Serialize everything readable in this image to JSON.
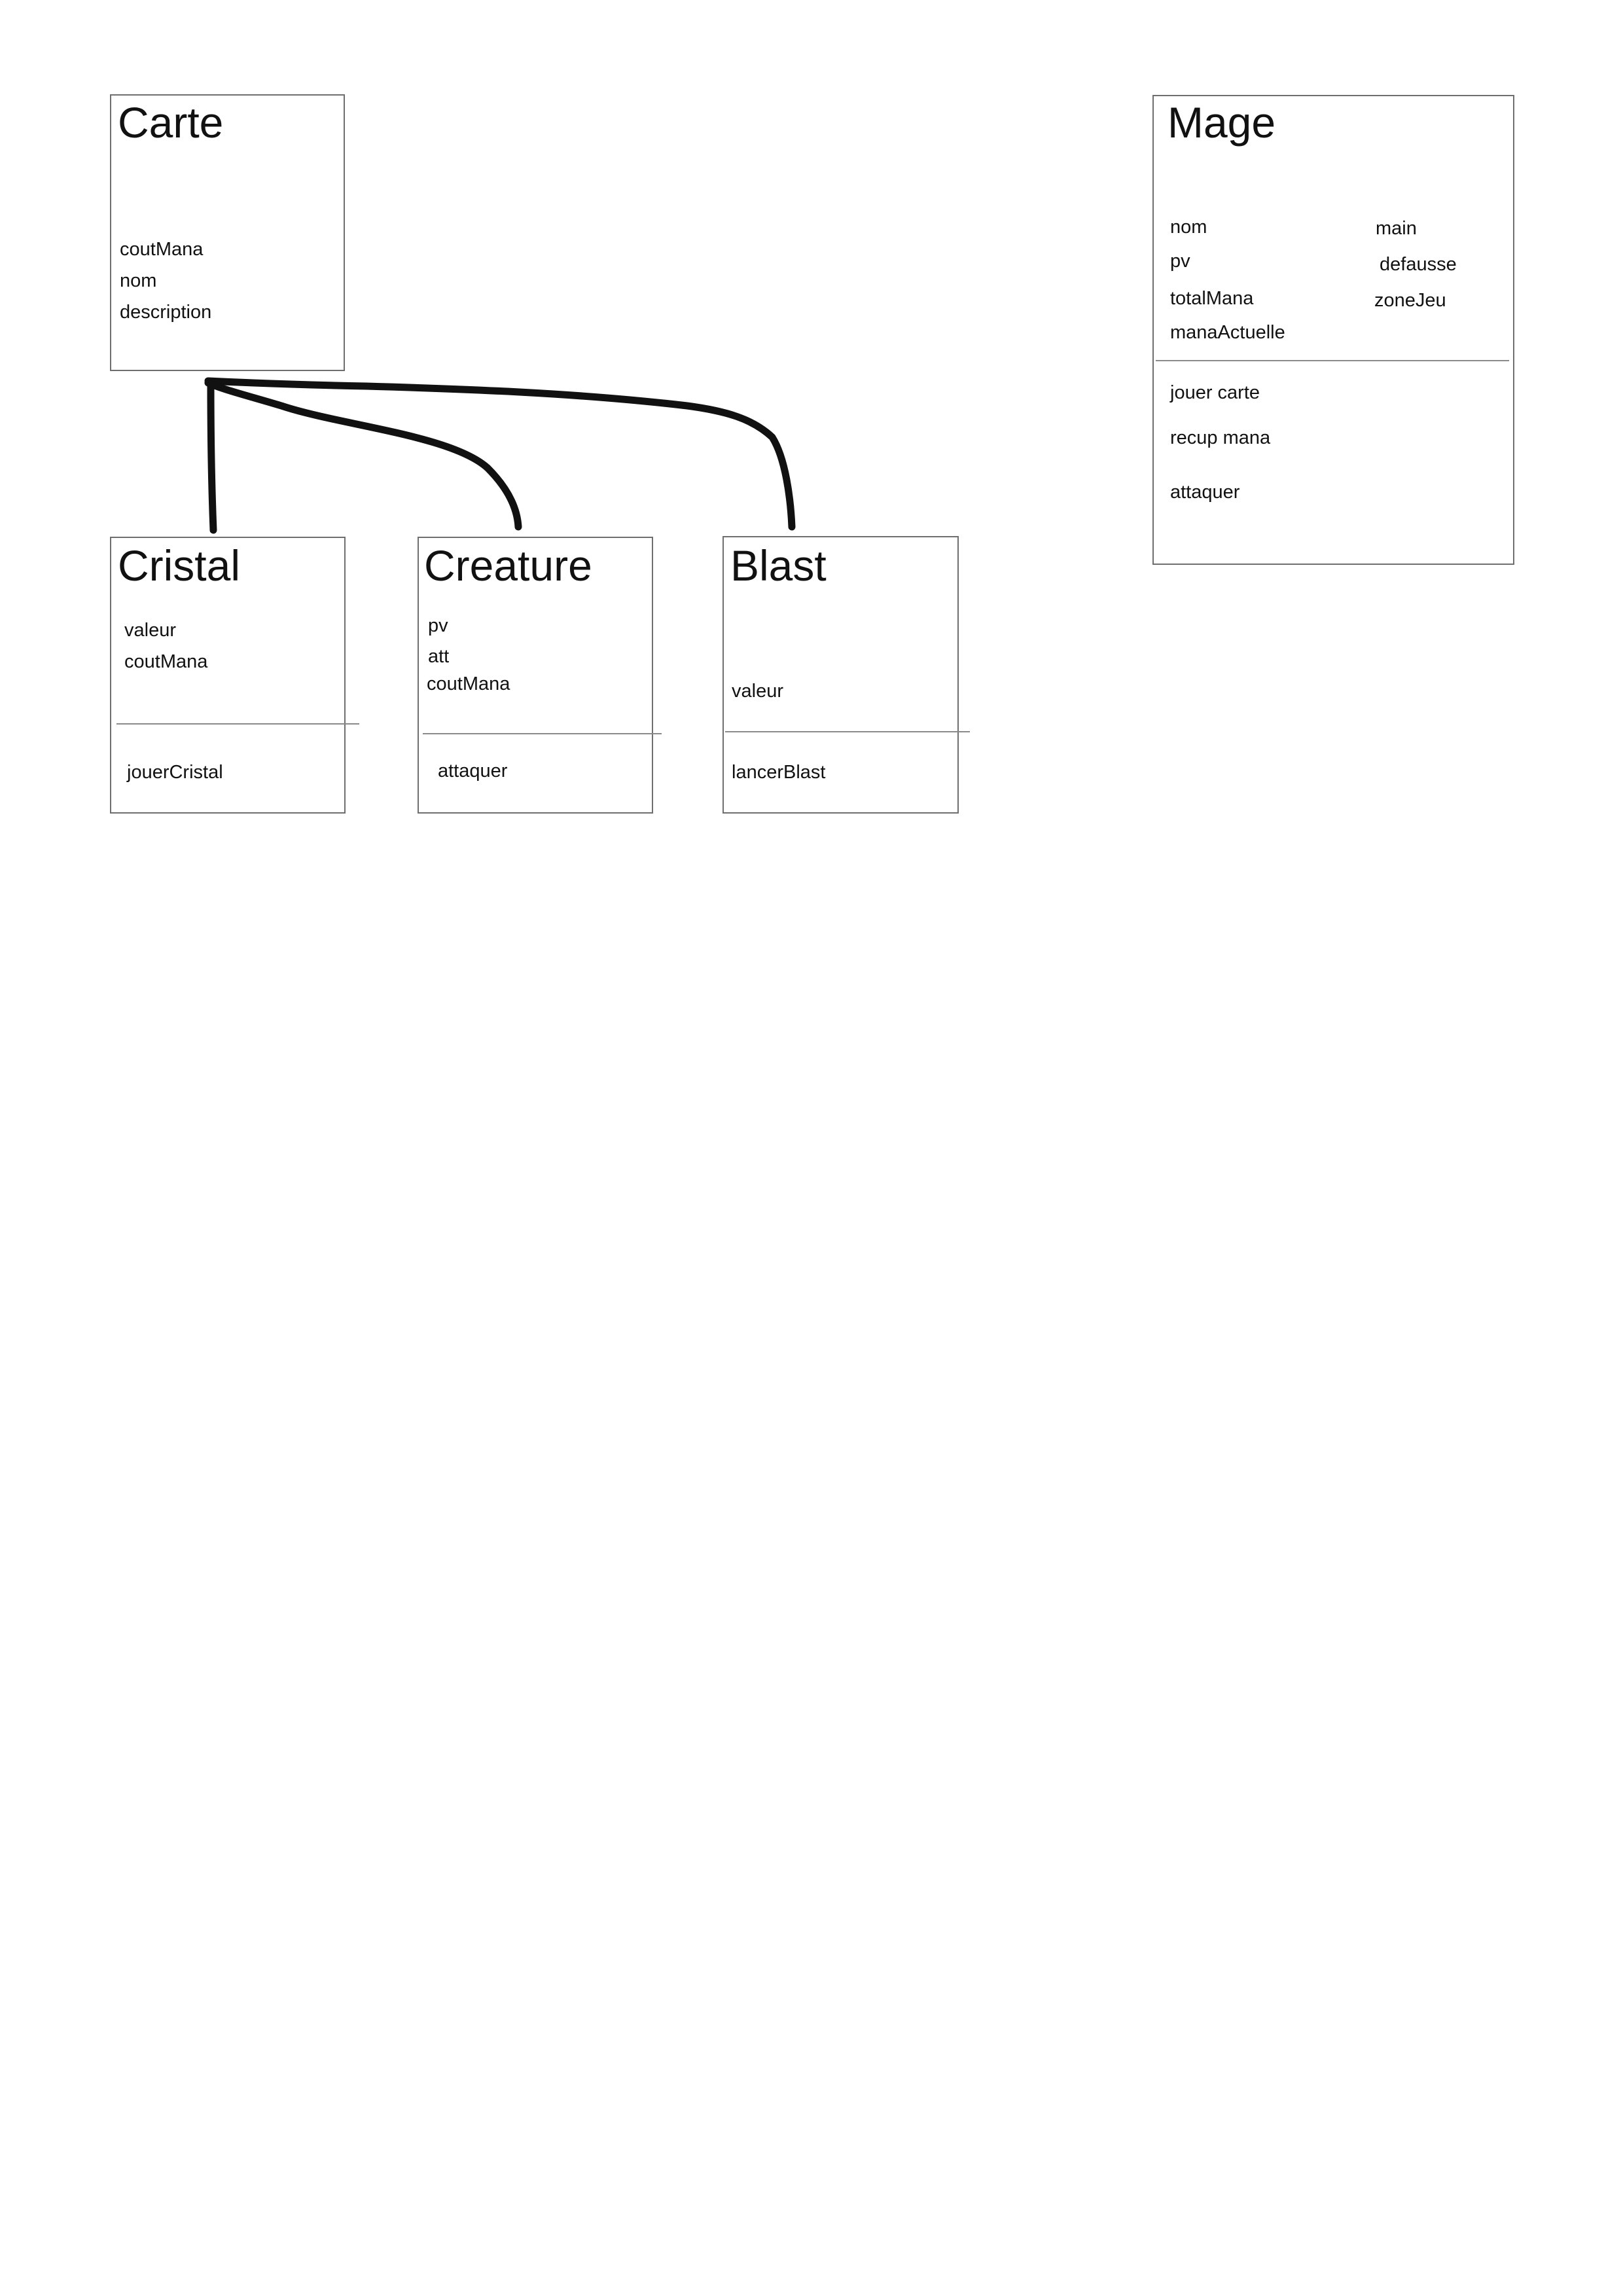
{
  "classes": {
    "carte": {
      "title": "Carte",
      "attributes": [
        "coutMana",
        "nom",
        "description"
      ]
    },
    "cristal": {
      "title": "Cristal",
      "attributes": [
        "valeur",
        "coutMana"
      ],
      "methods": [
        "jouerCristal"
      ]
    },
    "creature": {
      "title": "Creature",
      "attributes": [
        "pv",
        "att",
        "coutMana"
      ],
      "methods": [
        "attaquer"
      ]
    },
    "blast": {
      "title": "Blast",
      "attributes": [
        "valeur"
      ],
      "methods": [
        "lancerBlast"
      ]
    },
    "mage": {
      "title": "Mage",
      "attributes_left": [
        "nom",
        "pv",
        "totalMana",
        "manaActuelle"
      ],
      "attributes_right": [
        "main",
        "defausse",
        "zoneJeu"
      ],
      "methods": [
        "jouer carte",
        "recup mana",
        "attaquer"
      ]
    }
  },
  "relations": [
    {
      "from": "Cristal",
      "to": "Carte",
      "type": "inheritance"
    },
    {
      "from": "Creature",
      "to": "Carte",
      "type": "inheritance"
    },
    {
      "from": "Blast",
      "to": "Carte",
      "type": "inheritance"
    }
  ],
  "colors": {
    "box_border": "#6e6e6e",
    "divider": "#8a8a8a",
    "connector": "#111111",
    "text": "#111111"
  }
}
